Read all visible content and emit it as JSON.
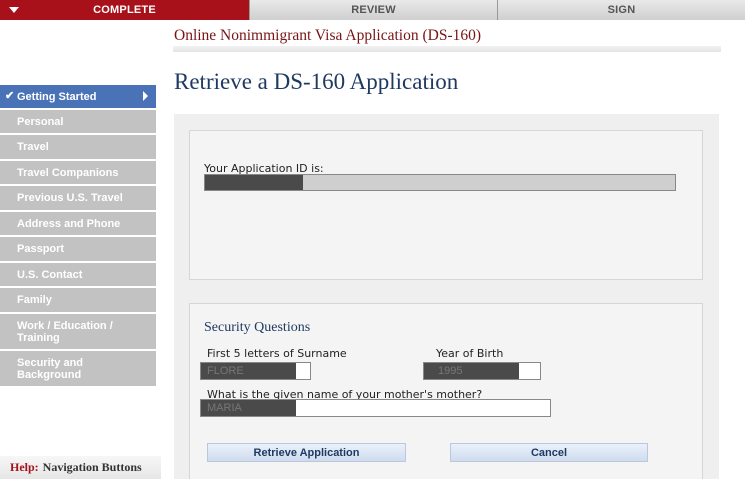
{
  "progress": {
    "steps": [
      {
        "label": "COMPLETE"
      },
      {
        "label": "REVIEW"
      },
      {
        "label": "SIGN"
      }
    ]
  },
  "header": {
    "app_title": "Online Nonimmigrant Visa Application (DS-160)",
    "page_title": "Retrieve a DS-160 Application"
  },
  "sidebar": {
    "items": [
      {
        "label": "Getting Started"
      },
      {
        "label": "Personal"
      },
      {
        "label": "Travel"
      },
      {
        "label": "Travel Companions"
      },
      {
        "label": "Previous U.S. Travel"
      },
      {
        "label": "Address and Phone"
      },
      {
        "label": "Passport"
      },
      {
        "label": "U.S. Contact"
      },
      {
        "label": "Family"
      },
      {
        "label": "Work / Education / Training"
      },
      {
        "label": "Security and Background"
      }
    ]
  },
  "help": {
    "label": "Help:",
    "text": "Navigation Buttons"
  },
  "application": {
    "id_label": "Your Application ID is:"
  },
  "security": {
    "title": "Security Questions",
    "surname_label": "First 5 letters of Surname",
    "surname_value": "FLORE",
    "yob_label": "Year of Birth",
    "yob_value": "1995",
    "mother_label": "What is the given name of your mother's mother?",
    "mother_value": "MARIA"
  },
  "buttons": {
    "retrieve": "Retrieve Application",
    "cancel": "Cancel"
  },
  "colors": {
    "accent_red": "#a8101a",
    "nav_active": "#4a73b7",
    "nav_inactive": "#c2c2c2",
    "title_blue": "#1f3a62"
  }
}
